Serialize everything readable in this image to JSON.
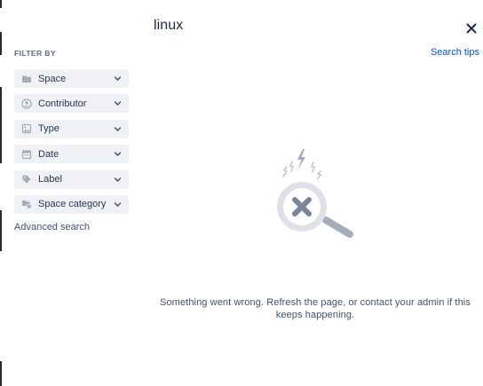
{
  "search": {
    "query": "linux"
  },
  "header": {
    "close_icon": "close-icon",
    "search_tips_label": "Search tips"
  },
  "filters": {
    "heading": "FILTER BY",
    "items": [
      {
        "label": "Space",
        "icon": "folder-icon"
      },
      {
        "label": "Contributor",
        "icon": "person-icon"
      },
      {
        "label": "Type",
        "icon": "image-icon"
      },
      {
        "label": "Date",
        "icon": "calendar-icon"
      },
      {
        "label": "Label",
        "icon": "tag-icon"
      },
      {
        "label": "Space category",
        "icon": "space-category-icon"
      }
    ],
    "advanced_label": "Advanced search"
  },
  "error": {
    "illustration": "broken-search-illustration",
    "message": "Something went wrong. Refresh the page, or contact your admin if this keeps happening."
  },
  "colors": {
    "link": "#0052cc",
    "text": "#172b4d",
    "muted": "#5e6c84",
    "filter_bg": "#f0f1f4"
  }
}
